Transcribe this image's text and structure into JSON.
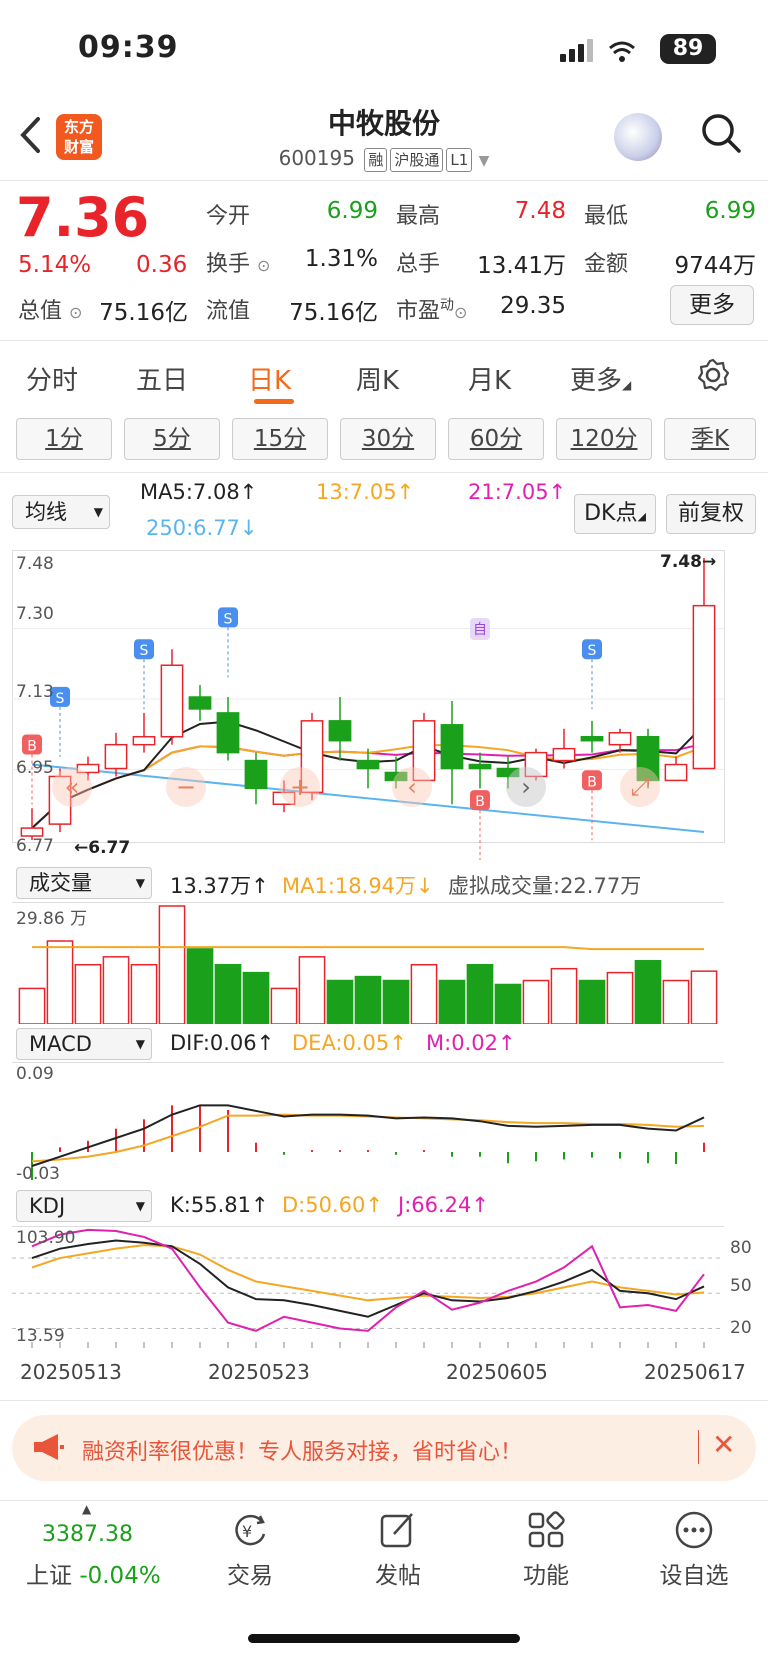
{
  "status": {
    "time": "09:39",
    "battery": "89"
  },
  "header": {
    "logo": [
      "东方",
      "财富"
    ],
    "name": "中牧股份",
    "code": "600195",
    "tags": [
      "融",
      "沪股通",
      "L1"
    ]
  },
  "quote": {
    "price": "7.36",
    "change_pct": "5.14%",
    "change_abs": "0.36",
    "open_label": "今开",
    "open": "6.99",
    "high_label": "最高",
    "high": "7.48",
    "low_label": "最低",
    "low": "6.99",
    "turnover_label": "换手",
    "turnover": "1.31%",
    "volume_label": "总手",
    "volume": "13.41万",
    "amount_label": "金额",
    "amount": "9744万",
    "mktcap_label": "总值",
    "mktcap": "75.16亿",
    "float_label": "流值",
    "float": "75.16亿",
    "pe_label": "市盈",
    "pe_sup": "动",
    "pe": "29.35",
    "more": "更多"
  },
  "tabs": [
    "分时",
    "五日",
    "日K",
    "周K",
    "月K",
    "更多"
  ],
  "periods": [
    "1分",
    "5分",
    "15分",
    "30分",
    "60分",
    "120分",
    "季K"
  ],
  "ma": {
    "select": "均线",
    "ma5": "MA5:7.08↑",
    "ma13": "13:7.05↑",
    "ma21": "21:7.05↑",
    "ma250": "250:6.77↓",
    "dk": "DK点",
    "fq": "前复权"
  },
  "kline_axis": {
    "top": "7.48",
    "l2": "7.30",
    "l3": "7.13",
    "l4": "6.95",
    "bottom": "6.77",
    "max_marker": "7.48→",
    "min_marker": "←6.77"
  },
  "markers": {
    "s": "S",
    "b": "B",
    "zi": "自"
  },
  "volume": {
    "select": "成交量",
    "v": "13.37万↑",
    "ma1": "MA1:18.94万↓",
    "virtual": "虚拟成交量:22.77万",
    "axis_top": "29.86 万"
  },
  "macd": {
    "select": "MACD",
    "dif": "DIF:0.06↑",
    "dea": "DEA:0.05↑",
    "m": "M:0.02↑",
    "axis_top": "0.09",
    "axis_bottom": "-0.03"
  },
  "kdj": {
    "select": "KDJ",
    "k": "K:55.81↑",
    "d": "D:50.60↑",
    "j": "J:66.24↑",
    "axis_top": "103.90",
    "axis_bottom": "13.59",
    "r80": "80",
    "r50": "50",
    "r20": "20"
  },
  "dates": [
    "20250513",
    "20250523",
    "20250605",
    "20250617"
  ],
  "chart_data": {
    "type": "candlestick",
    "ylim": [
      6.77,
      7.48
    ],
    "candles": [
      {
        "o": 6.78,
        "c": 6.8,
        "h": 6.85,
        "l": 6.77
      },
      {
        "o": 6.81,
        "c": 6.93,
        "h": 6.95,
        "l": 6.79
      },
      {
        "o": 6.94,
        "c": 6.96,
        "h": 6.98,
        "l": 6.92
      },
      {
        "o": 6.95,
        "c": 7.01,
        "h": 7.04,
        "l": 6.93
      },
      {
        "o": 7.01,
        "c": 7.03,
        "h": 7.09,
        "l": 6.99
      },
      {
        "o": 7.03,
        "c": 7.21,
        "h": 7.25,
        "l": 7.01
      },
      {
        "o": 7.13,
        "c": 7.1,
        "h": 7.16,
        "l": 7.07
      },
      {
        "o": 7.09,
        "c": 6.99,
        "h": 7.13,
        "l": 6.97
      },
      {
        "o": 6.97,
        "c": 6.9,
        "h": 6.99,
        "l": 6.86
      },
      {
        "o": 6.86,
        "c": 6.89,
        "h": 6.92,
        "l": 6.84
      },
      {
        "o": 6.89,
        "c": 7.07,
        "h": 7.09,
        "l": 6.87
      },
      {
        "o": 7.07,
        "c": 7.02,
        "h": 7.13,
        "l": 6.97
      },
      {
        "o": 6.97,
        "c": 6.95,
        "h": 7.0,
        "l": 6.9
      },
      {
        "o": 6.94,
        "c": 6.92,
        "h": 6.98,
        "l": 6.9
      },
      {
        "o": 6.92,
        "c": 7.07,
        "h": 7.09,
        "l": 6.92
      },
      {
        "o": 7.06,
        "c": 6.95,
        "h": 7.12,
        "l": 6.86
      },
      {
        "o": 6.96,
        "c": 6.95,
        "h": 6.99,
        "l": 6.9
      },
      {
        "o": 6.95,
        "c": 6.93,
        "h": 6.98,
        "l": 6.9
      },
      {
        "o": 6.93,
        "c": 6.99,
        "h": 7.0,
        "l": 6.92
      },
      {
        "o": 6.97,
        "c": 7.0,
        "h": 7.05,
        "l": 6.95
      },
      {
        "o": 7.03,
        "c": 7.02,
        "h": 7.07,
        "l": 6.99
      },
      {
        "o": 7.01,
        "c": 7.04,
        "h": 7.05,
        "l": 6.99
      },
      {
        "o": 7.03,
        "c": 6.92,
        "h": 7.05,
        "l": 6.9
      },
      {
        "o": 6.92,
        "c": 6.96,
        "h": 6.98,
        "l": 6.92
      },
      {
        "o": 6.95,
        "c": 7.36,
        "h": 7.48,
        "l": 6.95
      }
    ],
    "volumes": [
      9,
      21,
      15,
      17,
      15,
      29.86,
      19,
      15,
      13,
      9,
      17,
      11,
      12,
      11,
      15,
      11,
      15,
      10,
      11,
      14,
      11,
      13,
      16,
      11,
      13.37
    ],
    "dif": [
      -0.015,
      -0.005,
      0.005,
      0.015,
      0.025,
      0.04,
      0.05,
      0.05,
      0.044,
      0.038,
      0.04,
      0.04,
      0.039,
      0.036,
      0.037,
      0.036,
      0.033,
      0.028,
      0.027,
      0.028,
      0.029,
      0.029,
      0.025,
      0.023,
      0.037
    ],
    "dea": [
      -0.01,
      -0.008,
      -0.005,
      0.0,
      0.007,
      0.017,
      0.027,
      0.039,
      0.039,
      0.04,
      0.039,
      0.039,
      0.038,
      0.037,
      0.036,
      0.035,
      0.034,
      0.032,
      0.031,
      0.031,
      0.03,
      0.03,
      0.029,
      0.027,
      0.028
    ],
    "macd_bars": [
      -0.03,
      0.005,
      0.012,
      0.025,
      0.035,
      0.05,
      0.05,
      0.045,
      0.01,
      -0.003,
      0.002,
      0.002,
      0.002,
      -0.003,
      0.002,
      -0.005,
      -0.005,
      -0.012,
      -0.01,
      -0.008,
      -0.006,
      -0.007,
      -0.012,
      -0.013,
      0.01
    ],
    "k": [
      80,
      88,
      92,
      95,
      93,
      90,
      75,
      55,
      45,
      44,
      40,
      35,
      30,
      40,
      50,
      44,
      43,
      46,
      52,
      60,
      70,
      52,
      50,
      45,
      55.81
    ],
    "d": [
      72,
      80,
      84,
      88,
      91,
      90,
      83,
      70,
      60,
      56,
      52,
      48,
      44,
      46,
      48,
      47,
      46,
      47,
      50,
      55,
      60,
      55,
      52,
      49,
      50.6
    ],
    "j": [
      90,
      100,
      104,
      103,
      98,
      88,
      55,
      25,
      18,
      30,
      25,
      20,
      18,
      38,
      52,
      36,
      42,
      52,
      60,
      72,
      90,
      38,
      40,
      35,
      66.24
    ]
  },
  "banner": {
    "text": "融资利率很优惠！专人服务对接，省时省心！",
    "close": "✕"
  },
  "bottom": {
    "index_value": "3387.38",
    "index_label": "上证",
    "index_chg": "-0.04%",
    "items": [
      "交易",
      "发帖",
      "功能",
      "设自选"
    ]
  }
}
